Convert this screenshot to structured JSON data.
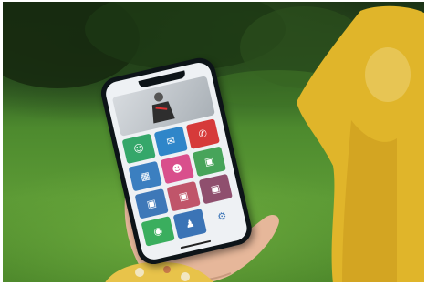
{
  "scene": {
    "colors": {
      "background_foliage": "#2f5a22",
      "grass": "#5c9a35",
      "yellow_object": "#e2b62c",
      "phone_frame": "#0d1418",
      "screen_bg": "#eef1f4",
      "skin": "#e6b79a",
      "sleeve": "#e8c34a"
    }
  },
  "phone": {
    "tiles": [
      {
        "color": "#35a76a",
        "icon": "person-icon"
      },
      {
        "color": "#2f86c9",
        "icon": "message-icon"
      },
      {
        "color": "#d63a3a",
        "icon": "phone-icon"
      },
      {
        "color": "#3b7fc0",
        "icon": "calendar-icon"
      },
      {
        "color": "#d94f8c",
        "icon": "people-icon"
      },
      {
        "color": "#47a45a",
        "icon": "photo-icon"
      },
      {
        "color": "#3e78b8",
        "icon": "photo-icon"
      },
      {
        "color": "#c0556a",
        "icon": "photo-icon"
      },
      {
        "color": "#8f4f6e",
        "icon": "photo-icon"
      },
      {
        "color": "#3aae5e",
        "icon": "whatsapp-icon"
      },
      {
        "color": "#3b74b6",
        "icon": "contact-icon"
      },
      {
        "color": "#eef1f4",
        "icon": "settings-icon"
      }
    ]
  }
}
